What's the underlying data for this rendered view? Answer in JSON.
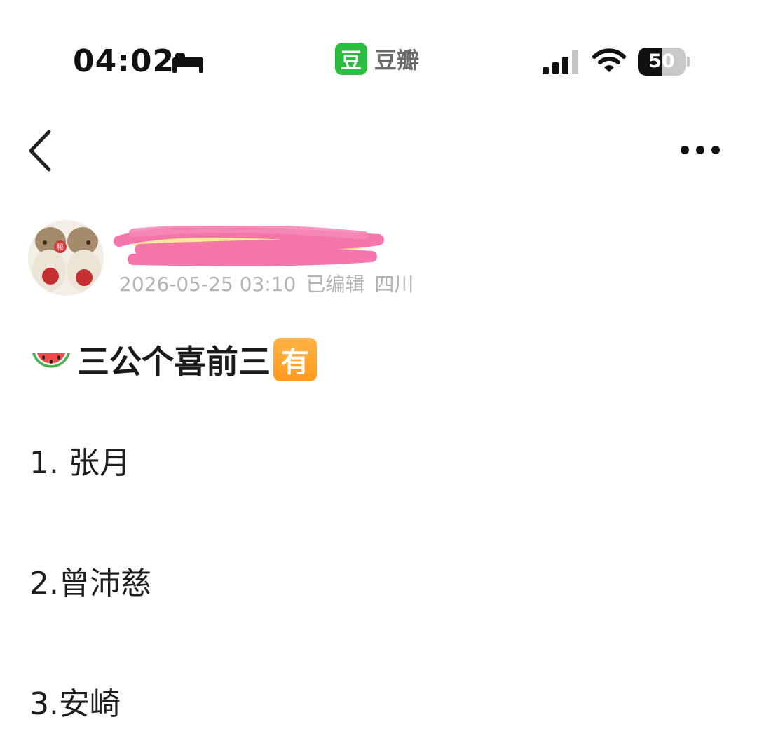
{
  "status_bar": {
    "time": "04:02",
    "sleep_icon": "bed-icon",
    "app_logo_char": "豆",
    "app_name": "豆瓣",
    "brand_color": "#2bbd3f",
    "signal_icon": "cellular-signal-icon",
    "wifi_icon": "wifi-icon",
    "battery_level": 50,
    "battery_text": "50"
  },
  "nav": {
    "back_icon": "chevron-left-icon",
    "more_icon": "more-dots-icon"
  },
  "post": {
    "author": {
      "avatar_icon": "avatar-plush-toys",
      "name_redacted": true
    },
    "date": "2026-05-25 03:10",
    "edited": "已编辑",
    "location": "四川",
    "title_icon": "watermelon-icon",
    "title": "三公个喜前三",
    "title_badge": "有",
    "badge_color": "#ff9a1f",
    "list": [
      "1. 张月",
      "2.曾沛慈",
      "3.安崎"
    ]
  }
}
